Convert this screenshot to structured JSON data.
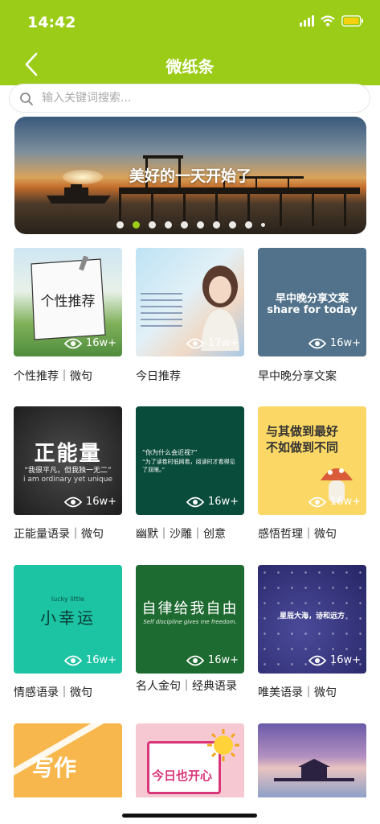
{
  "status_bar": {
    "time": "14:42"
  },
  "nav": {
    "title": "微纸条"
  },
  "search": {
    "placeholder": "输入关键词搜索..."
  },
  "banner": {
    "caption": "美好的一天开始了",
    "dot_count": 10,
    "active_dot": 1
  },
  "cards": [
    {
      "label": "个性推荐｜微句",
      "views": "16w+",
      "art_text": "个性推荐"
    },
    {
      "label": "今日推荐",
      "views": "17w+"
    },
    {
      "label": "早中晚分享文案",
      "views": "16w+",
      "art_line1": "早中晚分享文案",
      "art_line2": "share for today"
    },
    {
      "label": "正能量语录｜微句",
      "views": "16w+",
      "art_line1": "正能量",
      "art_line2": "“我很平凡，但我独一无二”",
      "art_line3": "i am ordinary yet unique"
    },
    {
      "label": "幽默｜沙雕｜创意",
      "views": "16w+",
      "art_line1": "“你为什么会近视?”",
      "art_line2": "“为了读卷时低网看，阅读时才看得见了双眼。”"
    },
    {
      "label": "感悟哲理｜微句",
      "views": "16w+",
      "art_line1": "与其做到最好",
      "art_line2": "不如做到不同"
    },
    {
      "label": "情感语录｜微句",
      "views": "16w+",
      "art_line1": "小幸运",
      "art_line2": "lucky little"
    },
    {
      "label": "名人金句｜经典语录",
      "views": "16w+",
      "art_line1": "自律给我自由",
      "art_line2": "Self discipline gives me freedom."
    },
    {
      "label": "唯美语录｜微句",
      "views": "16w+",
      "art_line1": "星辰大海，诗和远方"
    },
    {
      "art_text": "写作"
    },
    {
      "art_text": "今日也开心"
    },
    {}
  ],
  "colors": {
    "accent": "#9bcc17"
  }
}
